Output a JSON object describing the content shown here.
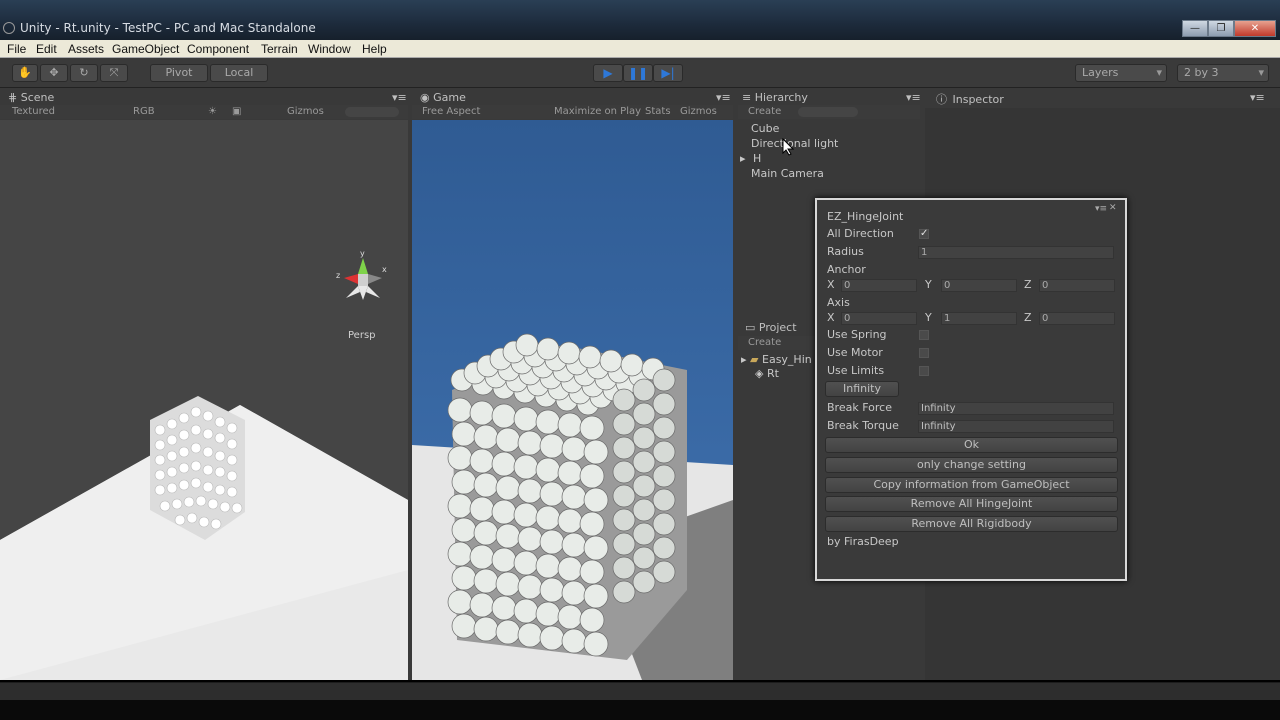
{
  "window": {
    "title": "Unity - Rt.unity - TestPC - PC and Mac Standalone"
  },
  "menu": [
    "File",
    "Edit",
    "Assets",
    "GameObject",
    "Component",
    "Terrain",
    "Window",
    "Help"
  ],
  "toolbar": {
    "pivot": "Pivot",
    "local": "Local",
    "layers": "Layers",
    "layout": "2 by 3"
  },
  "scene": {
    "tab": "Scene",
    "shading": "Textured",
    "render_mode": "RGB",
    "gizmos": "Gizmos",
    "persp": "Persp"
  },
  "game": {
    "tab": "Game",
    "aspect": "Free Aspect",
    "maximize": "Maximize on Play",
    "stats": "Stats",
    "gizmos": "Gizmos"
  },
  "hierarchy": {
    "tab": "Hierarchy",
    "create": "Create",
    "items": [
      "Cube",
      "Directional light",
      "H",
      "Main Camera"
    ]
  },
  "inspector": {
    "tab": "Inspector"
  },
  "project": {
    "tab": "Project",
    "create": "Create",
    "items": [
      "Easy_Hin",
      "Rt"
    ]
  },
  "ez_window": {
    "title": "EZ_HingeJoint",
    "all_direction_label": "All Direction",
    "all_direction_checked": true,
    "radius_label": "Radius",
    "radius_value": "1",
    "anchor_label": "Anchor",
    "anchor": {
      "x": "0",
      "y": "0",
      "z": "0"
    },
    "axis_label": "Axis",
    "axis": {
      "x": "0",
      "y": "1",
      "z": "0"
    },
    "x_label": "X",
    "y_label": "Y",
    "z_label": "Z",
    "use_spring": "Use Spring",
    "use_motor": "Use Motor",
    "use_limits": "Use Limits",
    "infinity_button": "Infinity",
    "break_force_label": "Break Force",
    "break_force_value": "Infinity",
    "break_torque_label": "Break Torque",
    "break_torque_value": "Infinity",
    "ok_button": "Ok",
    "only_change_button": "only change setting",
    "copy_button": "Copy information from GameObject",
    "remove_hinge_button": "Remove All HingeJoint",
    "remove_rigid_button": "Remove All Rigidbody",
    "credit": "by FirasDeep"
  },
  "colors": {
    "play_button": "#2e78d8",
    "sky": "#3a6aa6",
    "panel": "#393939"
  }
}
